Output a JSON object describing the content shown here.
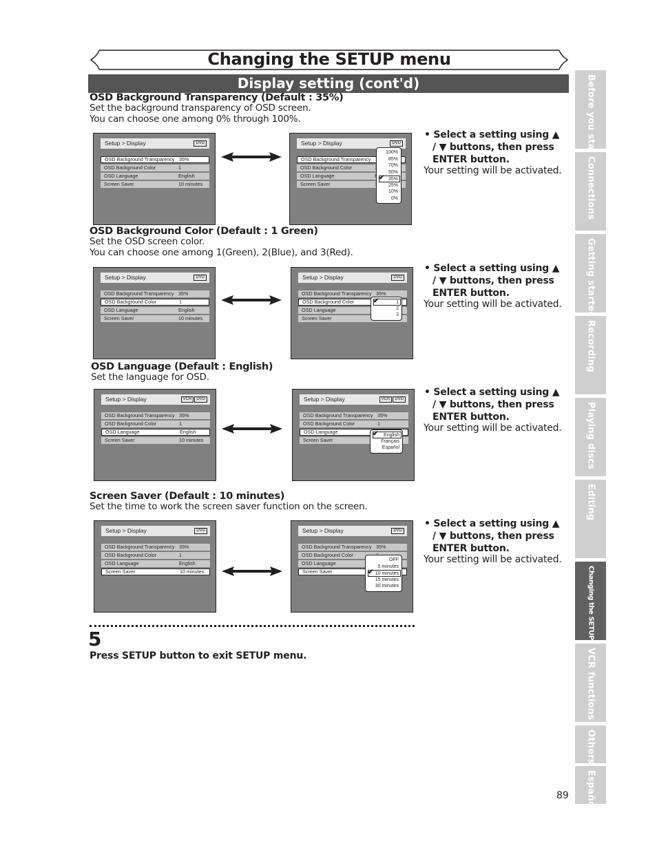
{
  "page": {
    "title": "Changing the SETUP menu",
    "section": "Display setting (cont'd)",
    "page_number": "89"
  },
  "sections": [
    {
      "heading": "OSD Background Transparency (Default : 35%)",
      "desc": [
        "Set the background transparency of OSD screen.",
        "You can choose one among 0% through 100%."
      ],
      "before": {
        "title": "Setup > Display",
        "badges": [
          "DVD"
        ],
        "selected": 0
      },
      "after": {
        "title": "Setup > Display",
        "badges": [
          "DVD"
        ],
        "selected": 0,
        "options": [
          "100%",
          "85%",
          "70%",
          "50%",
          "35%",
          "25%",
          "10%",
          "0%"
        ],
        "checked": 4
      }
    },
    {
      "heading": "OSD Background Color (Default : 1 Green)",
      "desc": [
        "Set the OSD screen color.",
        "You can choose one among 1(Green), 2(Blue), and 3(Red)."
      ],
      "before": {
        "title": "Setup > Display",
        "badges": [
          "DVD"
        ],
        "selected": 1
      },
      "after": {
        "title": "Setup > Display",
        "badges": [
          "DVD"
        ],
        "selected": 1,
        "options": [
          "1",
          "2",
          "3"
        ],
        "checked": 0
      }
    },
    {
      "heading": "OSD Language (Default : English)",
      "desc": [
        "Set the language for OSD."
      ],
      "before": {
        "title": "Setup > Display",
        "badges": [
          "VCR",
          "DVD"
        ],
        "selected": 2
      },
      "after": {
        "title": "Setup > Display",
        "badges": [
          "VCR",
          "DVD"
        ],
        "selected": 2,
        "options": [
          "English",
          "Français",
          "Español"
        ],
        "checked": 0
      }
    },
    {
      "heading": "Screen Saver (Default : 10 minutes)",
      "desc": [
        "Set the time to work the screen saver function on the screen."
      ],
      "before": {
        "title": "Setup > Display",
        "badges": [
          "DVD"
        ],
        "selected": 3
      },
      "after": {
        "title": "Setup > Display",
        "badges": [
          "DVD"
        ],
        "selected": 3,
        "options": [
          "OFF",
          "5 minutes",
          "10 minutes",
          "15 minutes",
          "30 minutes"
        ],
        "checked": 2
      }
    }
  ],
  "menu_rows": [
    {
      "label": "OSD Background Transparency",
      "value": "35%"
    },
    {
      "label": "OSD Background Color",
      "value": "1"
    },
    {
      "label": "OSD Language",
      "value": "English"
    },
    {
      "label": "Screen Saver",
      "value": "10 minutes"
    }
  ],
  "instruction": {
    "bullet": "• Select a setting using ▲ / ▼ buttons, then press ENTER button.",
    "note": "Your setting will be activated."
  },
  "step": {
    "number": "5",
    "text": "Press SETUP button to exit SETUP menu."
  },
  "side_tabs": [
    {
      "label": "Before you start",
      "active": false
    },
    {
      "label": "Connections",
      "active": false
    },
    {
      "label": "Getting started",
      "active": false
    },
    {
      "label": "Recording",
      "active": false
    },
    {
      "label": "Playing discs",
      "active": false
    },
    {
      "label": "Editing",
      "active": false
    },
    {
      "label": "Changing the SETUP menu",
      "active": true
    },
    {
      "label": "VCR functions",
      "active": false
    },
    {
      "label": "Others",
      "active": false
    },
    {
      "label": "Español",
      "active": false
    }
  ]
}
